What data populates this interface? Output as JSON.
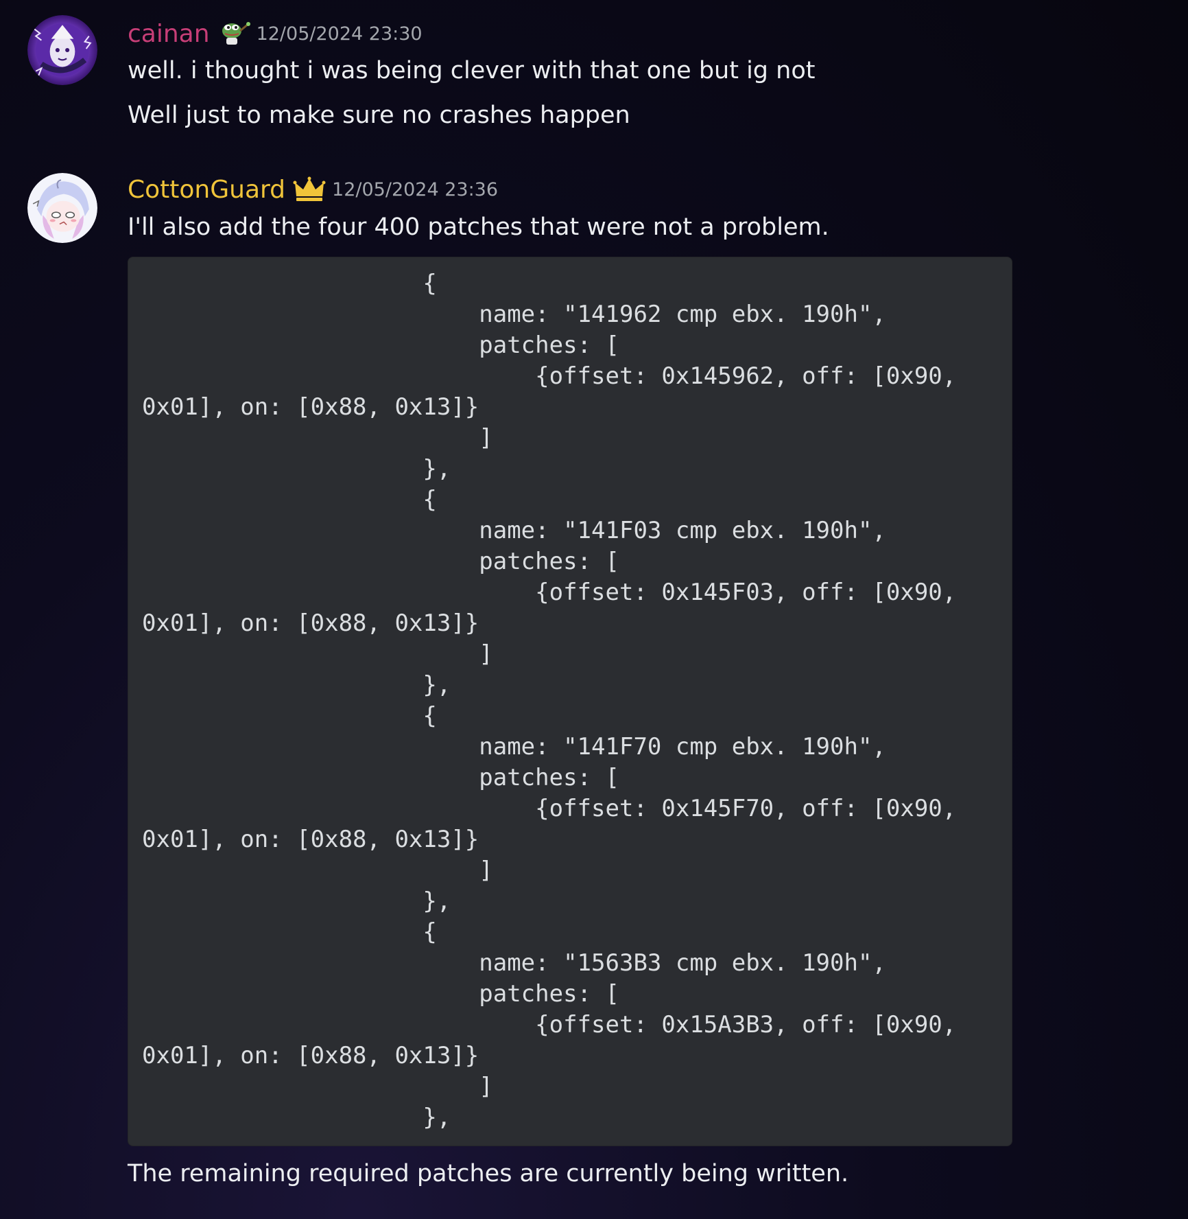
{
  "messages": [
    {
      "author": "cainan",
      "author_color": "#c73e77",
      "badge": "pepe-emoji-icon",
      "timestamp": "12/05/2024 23:30",
      "lines": [
        "well. i thought i was being clever with that one but ig not",
        "Well just to make sure no crashes happen"
      ]
    },
    {
      "author": "CottonGuard",
      "author_color": "#f0c43a",
      "badge": "crown-icon",
      "timestamp": "12/05/2024 23:36",
      "lines": [
        "I'll also add the four 400 patches that were not a problem."
      ],
      "code": "                    {\n                        name: \"141962 cmp ebx. 190h\",\n                        patches: [\n                            {offset: 0x145962, off: [0x90,\n0x01], on: [0x88, 0x13]}\n                        ]\n                    },\n                    {\n                        name: \"141F03 cmp ebx. 190h\",\n                        patches: [\n                            {offset: 0x145F03, off: [0x90,\n0x01], on: [0x88, 0x13]}\n                        ]\n                    },\n                    {\n                        name: \"141F70 cmp ebx. 190h\",\n                        patches: [\n                            {offset: 0x145F70, off: [0x90,\n0x01], on: [0x88, 0x13]}\n                        ]\n                    },\n                    {\n                        name: \"1563B3 cmp ebx. 190h\",\n                        patches: [\n                            {offset: 0x15A3B3, off: [0x90,\n0x01], on: [0x88, 0x13]}\n                        ]\n                    },",
      "after_code": "The remaining required patches are currently being written."
    }
  ]
}
